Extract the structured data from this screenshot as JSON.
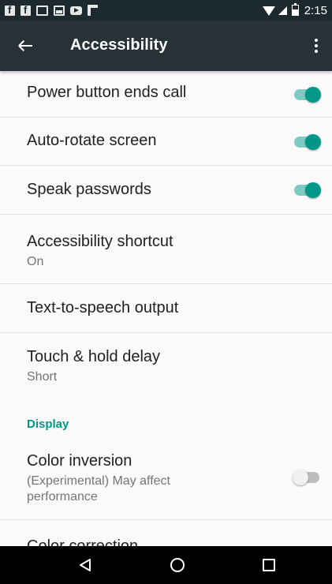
{
  "status_bar": {
    "time": "2:15",
    "left_icons": [
      "facebook-icon",
      "facebook-icon",
      "gmail-icon",
      "gallery-icon",
      "youtube-icon",
      "flipboard-icon"
    ],
    "right_icons": [
      "wifi-icon",
      "cell-signal-icon",
      "battery-icon"
    ]
  },
  "app_bar": {
    "title": "Accessibility",
    "background": "#263238",
    "back_icon": "arrow-back-icon",
    "menu_icon": "more-vert-icon"
  },
  "settings": {
    "power_button": {
      "title": "Power button ends call",
      "checked": true
    },
    "auto_rotate": {
      "title": "Auto-rotate screen",
      "checked": true
    },
    "speak_passwords": {
      "title": "Speak passwords",
      "checked": true
    },
    "shortcut": {
      "title": "Accessibility shortcut",
      "summary": "On"
    },
    "tts": {
      "title": "Text-to-speech output"
    },
    "touch_hold": {
      "title": "Touch & hold delay",
      "summary": "Short"
    },
    "display_header": "Display",
    "color_inversion": {
      "title": "Color inversion",
      "summary": "(Experimental) May affect performance",
      "checked": false
    },
    "color_correction": {
      "title": "Color correction"
    }
  },
  "colors": {
    "accent": "#009688",
    "switch_track_on": "#7fcbc4",
    "switch_off": "#bdbdbd"
  },
  "nav_bar": {
    "back": "nav-back-icon",
    "home": "nav-home-icon",
    "recents": "nav-recents-icon"
  }
}
